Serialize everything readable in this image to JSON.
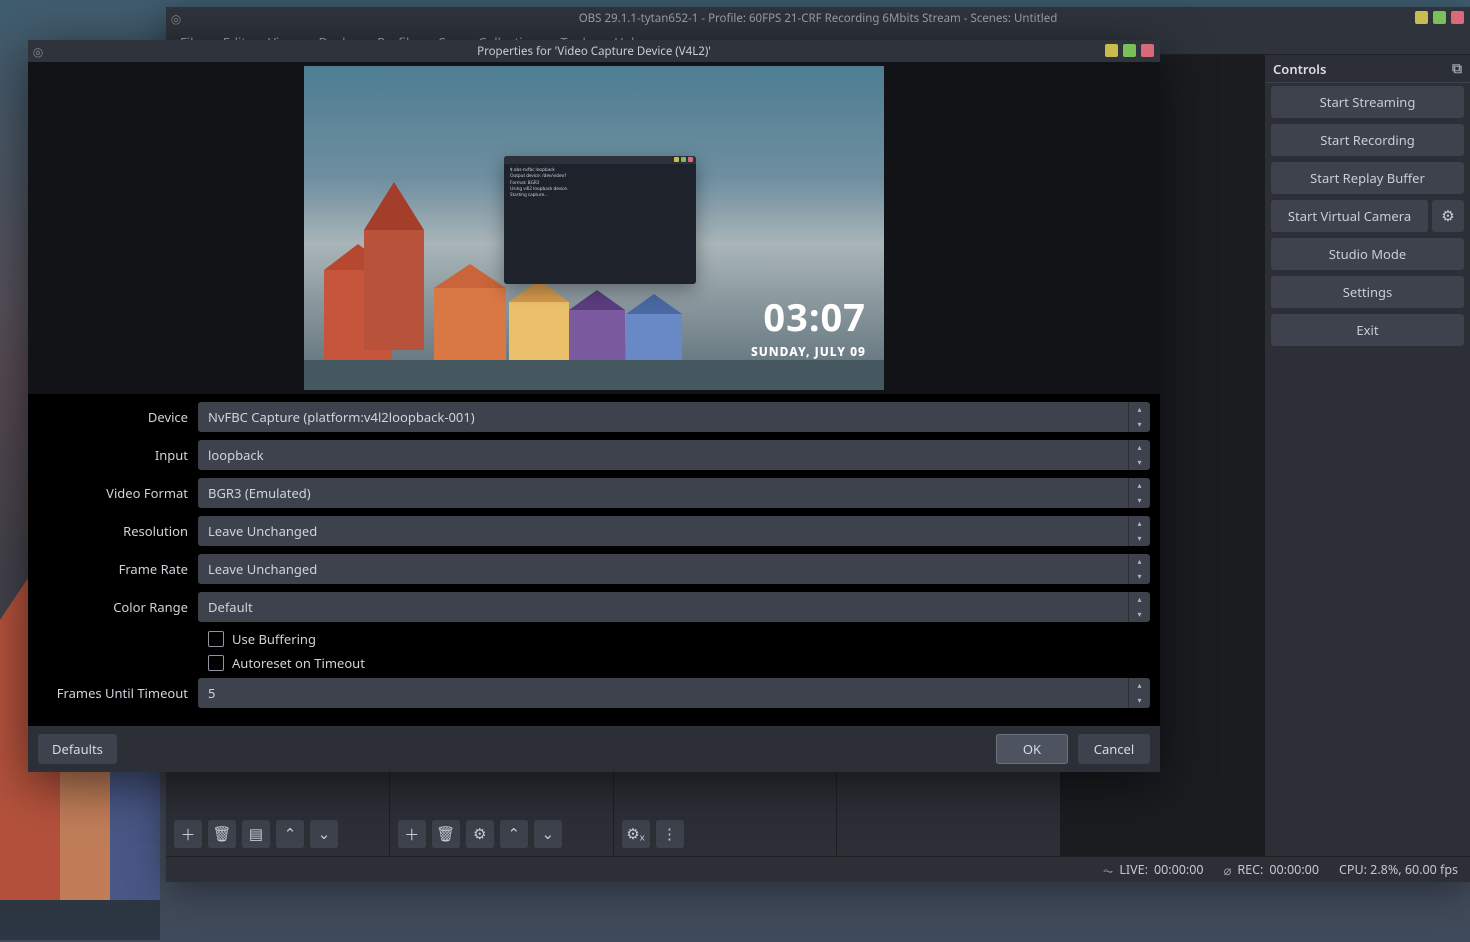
{
  "main_window": {
    "title": "OBS 29.1.1-tytan652-1 - Profile: 60FPS 21-CRF Recording 6Mbits Stream - Scenes: Untitled",
    "menubar": [
      "File",
      "Edit",
      "View",
      "Docks",
      "Profile",
      "Scene Collection",
      "Tools",
      "Help"
    ]
  },
  "controls": {
    "header": "Controls",
    "buttons": {
      "start_streaming": "Start Streaming",
      "start_recording": "Start Recording",
      "start_replay": "Start Replay Buffer",
      "start_vcam": "Start Virtual Camera",
      "studio_mode": "Studio Mode",
      "settings": "Settings",
      "exit": "Exit"
    }
  },
  "status": {
    "live_label": "LIVE:",
    "live_time": "00:00:00",
    "rec_label": "REC:",
    "rec_time": "00:00:00",
    "cpu": "CPU: 2.8%, 60.00 fps"
  },
  "dialog": {
    "title": "Properties for 'Video Capture Device (V4L2)'",
    "fields": {
      "device": {
        "label": "Device",
        "value": "NvFBC Capture (platform:v4l2loopback-001)"
      },
      "input": {
        "label": "Input",
        "value": "loopback"
      },
      "video_format": {
        "label": "Video Format",
        "value": "BGR3 (Emulated)"
      },
      "resolution": {
        "label": "Resolution",
        "value": "Leave Unchanged"
      },
      "frame_rate": {
        "label": "Frame Rate",
        "value": "Leave Unchanged"
      },
      "color_range": {
        "label": "Color Range",
        "value": "Default"
      },
      "use_buffering": "Use Buffering",
      "autoreset": "Autoreset on Timeout",
      "frames_timeout": {
        "label": "Frames Until Timeout",
        "value": "5"
      }
    },
    "buttons": {
      "defaults": "Defaults",
      "ok": "OK",
      "cancel": "Cancel"
    },
    "preview_clock": {
      "time": "03:07",
      "date": "SUNDAY, JULY 09"
    },
    "terminal_lines": [
      "$ obs-nvfbc loopback",
      "Output device: /dev/video1",
      "Format: BGR3",
      "Using v4l2 loopback device.",
      "Starting capture..."
    ]
  },
  "icons": {
    "plus": "＋",
    "trash": "🗑",
    "filter": "▤",
    "up": "⌃",
    "down": "⌄",
    "gear": "⚙",
    "more": "⋮",
    "gear2": "⚙ₓ",
    "popout": "⧉",
    "signal": "⏦",
    "disk": "⌀"
  }
}
